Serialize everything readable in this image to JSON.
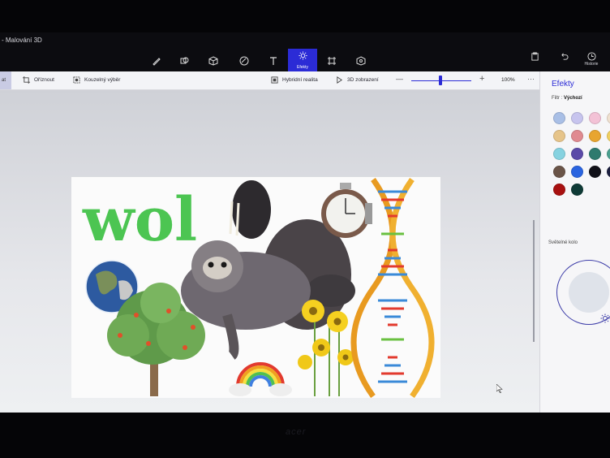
{
  "app": {
    "title": "- Malování 3D"
  },
  "toolbar": {
    "effects_label": "Efekty",
    "history_label": "Historie"
  },
  "commands": {
    "active_partial": "at",
    "crop_label": "Oříznout",
    "magic_select_label": "Kouzelný výběr",
    "mixed_reality_label": "Hybridní realita",
    "view3d_label": "3D zobrazení",
    "zoom_value": "100%",
    "more_label": "···"
  },
  "panel": {
    "title": "Efekty",
    "filter_prefix": "Filtr : ",
    "filter_value": "Výchozí",
    "light_wheel_label": "Světelné kolo",
    "swatch_colors": [
      "#a9bfe6",
      "#c7c4ee",
      "#f3c2d6",
      "#f0e1d0",
      "#e6c48a",
      "#e08a90",
      "#e8a530",
      "#f0d060",
      "#86d2e0",
      "#5a4aa8",
      "#2e7a6e",
      "#4aa090",
      "#6a5448",
      "#2a64e0",
      "#101018",
      "#1c2040",
      "#a81010",
      "#0e3a36"
    ]
  },
  "canvas": {
    "letters_text": "wol",
    "colors": {
      "letters": "#4cc552",
      "rainbow_red": "#e23a2e",
      "dna_orange": "#e89a20",
      "accent": "#2b2bd6"
    }
  },
  "device": {
    "brand": "acer"
  }
}
